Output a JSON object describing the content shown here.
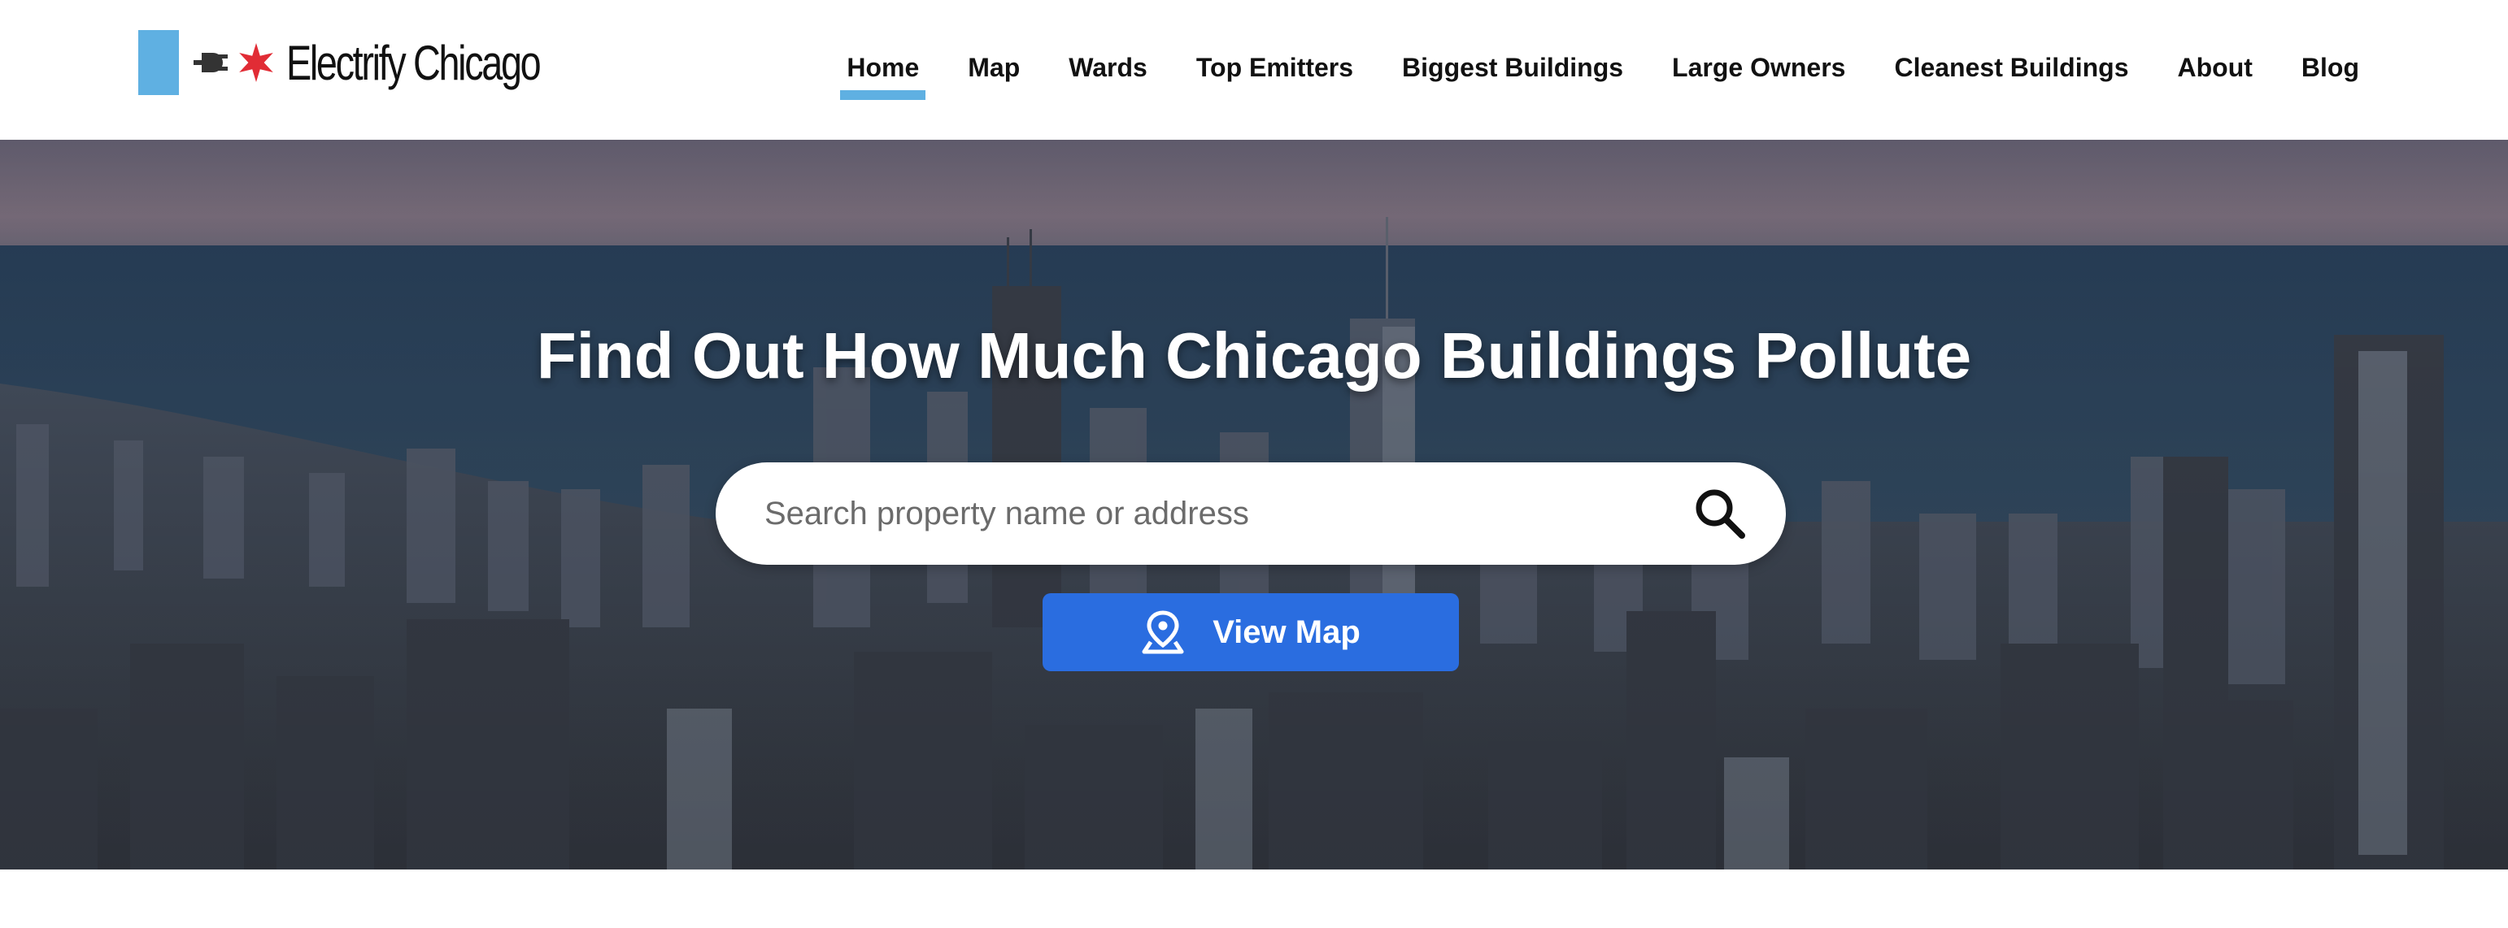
{
  "header": {
    "logo": {
      "text": "Electrify Chicago",
      "flag_color": "#5fb0e2",
      "star_color": "#e12c35",
      "plug_icon": "plug-icon",
      "star_icon": "chicago-star-icon"
    },
    "nav": {
      "items": [
        {
          "label": "Home",
          "active": true
        },
        {
          "label": "Map"
        },
        {
          "label": "Wards"
        },
        {
          "label": "Top Emitters"
        },
        {
          "label": "Biggest Buildings"
        },
        {
          "label": "Large Owners"
        },
        {
          "label": "Cleanest Buildings"
        },
        {
          "label": "About"
        },
        {
          "label": "Blog"
        }
      ],
      "active_underline_color": "#5fb0e2"
    }
  },
  "hero": {
    "title": "Find Out How Much Chicago Buildings Pollute",
    "search": {
      "placeholder": "Search property name or address",
      "value": "",
      "icon": "search-icon"
    },
    "view_map": {
      "label": "View Map",
      "icon": "map-pin-icon",
      "color": "#2a6de0"
    }
  }
}
